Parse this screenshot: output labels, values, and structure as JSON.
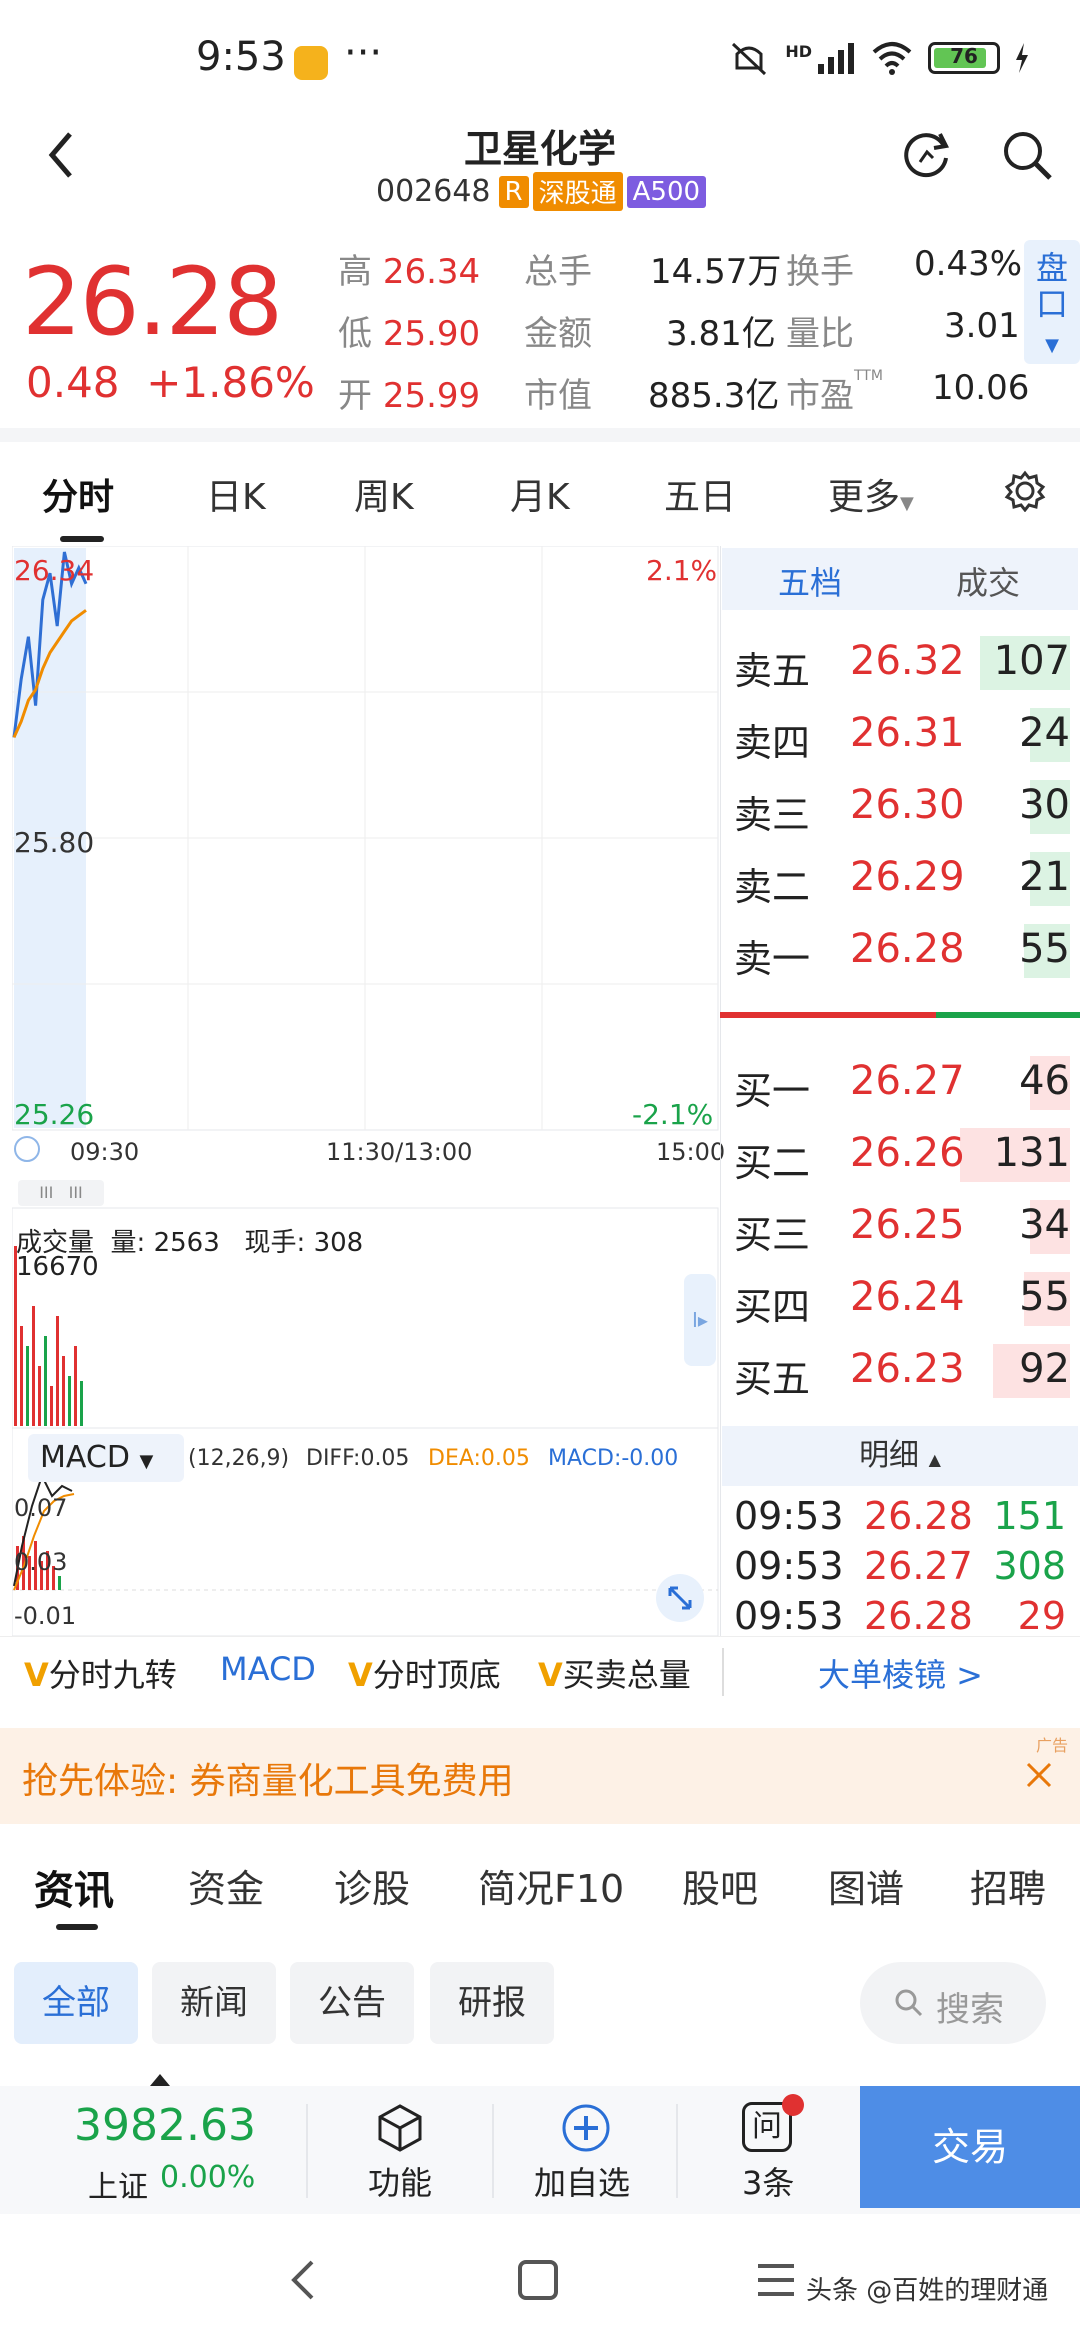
{
  "status_bar": {
    "time": "9:53",
    "battery": "76",
    "signal_label": "HD"
  },
  "header": {
    "title": "卫星化学",
    "code": "002648",
    "tags": [
      "R",
      "深股通",
      "A500"
    ]
  },
  "quote": {
    "price": "26.28",
    "change": "0.48",
    "change_pct": "+1.86%",
    "high_label": "高",
    "high": "26.34",
    "low_label": "低",
    "low": "25.90",
    "open_label": "开",
    "open": "25.99",
    "volume_label": "总手",
    "volume": "14.57万",
    "amount_label": "金额",
    "amount": "3.81亿",
    "mcap_label": "市值",
    "mcap": "885.3亿",
    "turnover_label": "换手",
    "turnover": "0.43%",
    "vol_ratio_label": "量比",
    "vol_ratio": "3.01",
    "pe_label": "市盈",
    "pe_tag": "TTM",
    "pe": "10.06",
    "pankou_label": "盘口"
  },
  "chart_tabs": [
    "分时",
    "日K",
    "周K",
    "月K",
    "五日",
    "更多"
  ],
  "intraday": {
    "y_top": "26.34",
    "y_mid": "25.80",
    "y_bottom": "25.26",
    "pct_top": "2.1%",
    "pct_bottom": "-2.1%",
    "t_start": "09:30",
    "t_mid": "11:30/13:00",
    "t_end": "15:00",
    "volume_title": "成交量",
    "volume_text": "量: 2563",
    "current_hand": "现手: 308",
    "volume_max": "16670",
    "macd_name": "MACD",
    "macd_params": "(12,26,9)",
    "diff": "DIFF:0.05",
    "dea": "DEA:0.05",
    "macd": "MACD:-0.00",
    "macd_y1": "0.07",
    "macd_y2": "0.03",
    "macd_y3": "-0.01"
  },
  "chart_data": {
    "type": "line",
    "title": "",
    "ylim": [
      25.26,
      26.34
    ],
    "series": [
      {
        "values": [
          25.99,
          26.1,
          26.18,
          26.05,
          26.25,
          26.3,
          26.2,
          26.34,
          26.28,
          26.31,
          26.28
        ]
      },
      {
        "values": [
          25.99,
          26.02,
          26.06,
          26.08,
          26.12,
          26.15,
          26.17,
          26.19,
          26.21,
          26.22,
          26.23
        ]
      }
    ]
  },
  "orderbook": {
    "tab_five": "五档",
    "tab_trades": "成交",
    "asks": [
      {
        "label": "卖五",
        "price": "26.32",
        "vol": "107"
      },
      {
        "label": "卖四",
        "price": "26.31",
        "vol": "24"
      },
      {
        "label": "卖三",
        "price": "26.30",
        "vol": "30"
      },
      {
        "label": "卖二",
        "price": "26.29",
        "vol": "21"
      },
      {
        "label": "卖一",
        "price": "26.28",
        "vol": "55"
      }
    ],
    "bids": [
      {
        "label": "买一",
        "price": "26.27",
        "vol": "46"
      },
      {
        "label": "买二",
        "price": "26.26",
        "vol": "131"
      },
      {
        "label": "买三",
        "price": "26.25",
        "vol": "34"
      },
      {
        "label": "买四",
        "price": "26.24",
        "vol": "55"
      },
      {
        "label": "买五",
        "price": "26.23",
        "vol": "92"
      }
    ],
    "detail_label": "明细",
    "details": [
      {
        "time": "09:53",
        "price": "26.28",
        "vol": "151"
      },
      {
        "time": "09:53",
        "price": "26.27",
        "vol": "308"
      },
      {
        "time": "09:53",
        "price": "26.28",
        "vol": "29"
      }
    ]
  },
  "indicators": {
    "i1": "分时九转",
    "i2": "MACD",
    "i3": "分时顶底",
    "i4": "买卖总量",
    "big_order": "大单棱镜 >"
  },
  "ad": {
    "text": "抢先体验: 券商量化工具免费用",
    "tag": "广告"
  },
  "news_tabs": [
    "资讯",
    "资金",
    "诊股",
    "简况F10",
    "股吧",
    "图谱",
    "招聘"
  ],
  "news_filters": [
    "全部",
    "新闻",
    "公告",
    "研报"
  ],
  "search_placeholder": "搜索",
  "bottom": {
    "index_value": "3982.63",
    "index_name": "上证",
    "index_change": "0.00%",
    "func": "功能",
    "add_watch": "加自选",
    "ask_count": "3条",
    "ask_glyph": "问",
    "trade": "交易"
  },
  "watermark": "头条 @百姓的理财通",
  "colors": {
    "up": "#e03131",
    "down": "#1aa34a",
    "accent": "#2a6fd6",
    "orange": "#f08c00"
  }
}
